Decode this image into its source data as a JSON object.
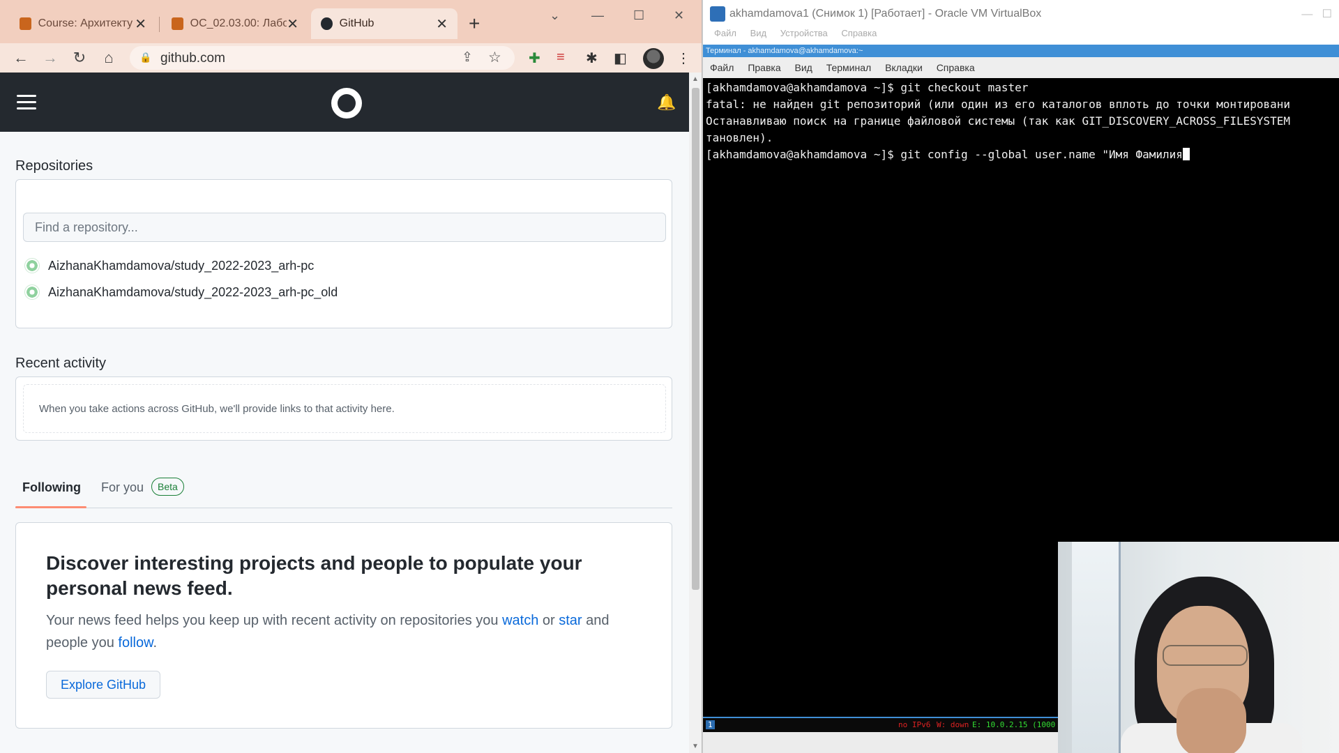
{
  "browser": {
    "tabs": [
      {
        "title": "Course: Архитекту",
        "active": false
      },
      {
        "title": "ОС_02.03.00: Лабо",
        "active": false
      },
      {
        "title": "GitHub",
        "active": true
      }
    ],
    "url": "github.com"
  },
  "github": {
    "repositories_title": "Repositories",
    "search_placeholder": "Find a repository...",
    "repos": [
      "AizhanaKhamdamova/study_2022-2023_arh-pc",
      "AizhanaKhamdamova/study_2022-2023_arh-pc_old"
    ],
    "recent_activity_title": "Recent activity",
    "recent_activity_text": "When you take actions across GitHub, we'll provide links to that activity here.",
    "tab_following": "Following",
    "tab_for_you": "For you",
    "beta_badge": "Beta",
    "discover_title": "Discover interesting projects and people to populate your personal news feed.",
    "discover_text_1": "Your news feed helps you keep up with recent activity on repositories you ",
    "link_watch": "watch",
    "discover_or": " or ",
    "link_star": "star",
    "discover_text_2": " and people you ",
    "link_follow": "follow",
    "discover_period": ".",
    "explore_button": "Explore GitHub"
  },
  "vbox": {
    "title": "akhamdamova1 (Снимок 1) [Работает] - Oracle VM VirtualBox",
    "menu": [
      "Файл",
      "Вид",
      "Устройства",
      "Справка"
    ],
    "guest_title": "Терминал - akhamdamova@akhamdamova:~",
    "terminal_menu": [
      "Файл",
      "Правка",
      "Вид",
      "Терминал",
      "Вкладки",
      "Справка"
    ],
    "terminal_lines": [
      "[akhamdamova@akhamdamova ~]$ git checkout master",
      "fatal: не найден git репозиторий (или один из его каталогов вплоть до точки монтировани",
      "Останавливаю поиск на границе файловой системы (так как GIT_DISCOVERY_ACROSS_FILESYSTEM",
      "тановлен)."
    ],
    "terminal_prompt": "[akhamdamova@akhamdamova ~]$ git config --global user.name \"Имя Фамилия",
    "status_ws": "1",
    "status_ipv6": "no IPv6",
    "status_w": "W: down",
    "status_e": "E: 10.0.2.15 (1000"
  },
  "colors": {
    "tabstrip": "#f2cfbf",
    "github_header": "#24292f",
    "github_link": "#0969da",
    "terminal_bg": "#000000",
    "vbox_accent": "#3f8fd6"
  }
}
